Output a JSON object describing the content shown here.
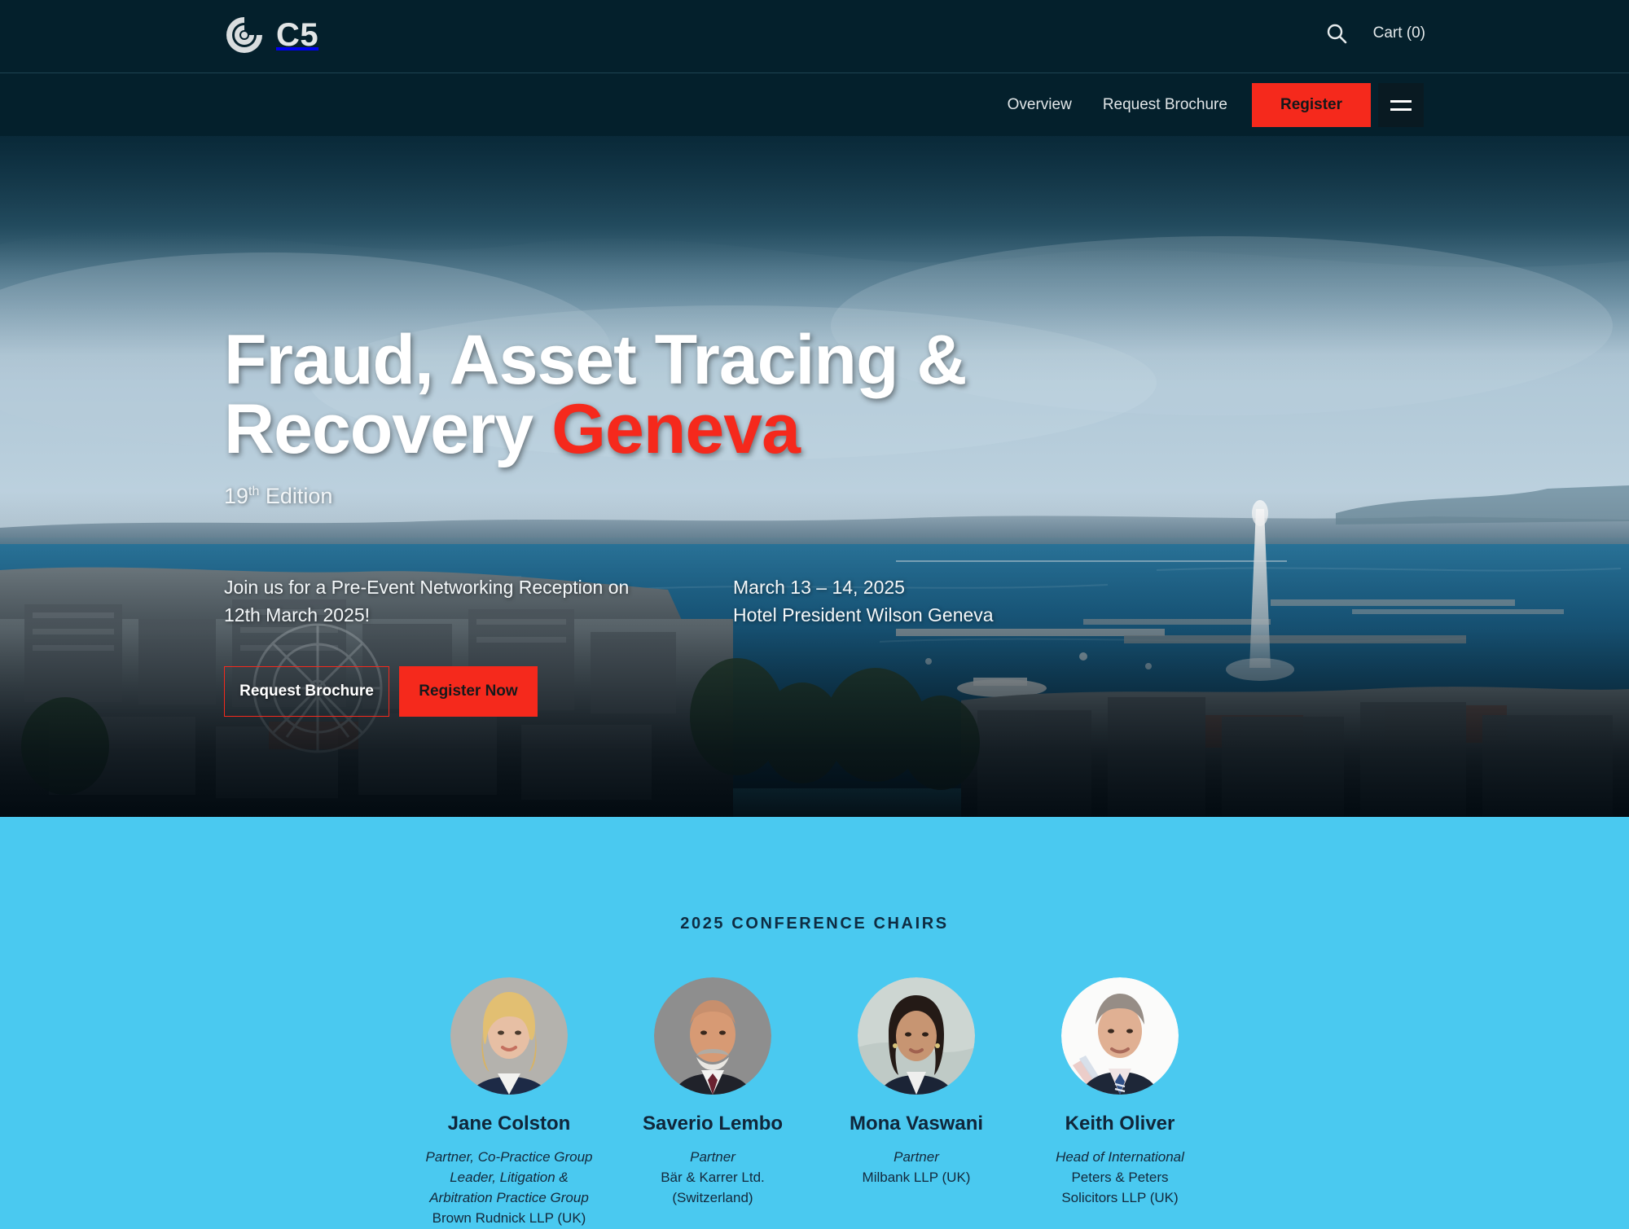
{
  "brand": {
    "name": "C5",
    "logo_icon": "c5-spiral-logo-icon"
  },
  "topbar": {
    "search_icon": "search-icon",
    "cart_label": "Cart (0)"
  },
  "subnav": {
    "links": [
      {
        "label": "Overview"
      },
      {
        "label": "Request Brochure"
      }
    ],
    "register_label": "Register",
    "menu_icon": "hamburger-menu-icon"
  },
  "hero": {
    "title_line1": "Fraud, Asset Tracing &",
    "title_line2_plain": "Recovery ",
    "title_line2_accent": "Geneva",
    "edition_number": "19",
    "edition_suffix": "th",
    "edition_word": " Edition",
    "reception_line1": "Join us for a Pre-Event Networking Reception on",
    "reception_line2": "12th March 2025!",
    "dates": "March 13 – 14, 2025",
    "venue": "Hotel President Wilson Geneva",
    "btn_brochure": "Request Brochure",
    "btn_register": "Register Now",
    "accent_color": "#f5291c",
    "background_image": "geneva-lake-jet-deau-aerial-photo"
  },
  "chairs": {
    "heading": "2025 CONFERENCE CHAIRS",
    "background_color": "#4ac9f0",
    "people": [
      {
        "name": "Jane Colston",
        "title_lines": [
          "Partner, Co-Practice Group",
          "Leader, Litigation &",
          "Arbitration Practice Group"
        ],
        "firm_lines": [
          "Brown Rudnick LLP (UK)"
        ],
        "photo": "portrait-jane-colston"
      },
      {
        "name": "Saverio Lembo",
        "title_lines": [
          "Partner"
        ],
        "firm_lines": [
          "Bär & Karrer Ltd.",
          "(Switzerland)"
        ],
        "photo": "portrait-saverio-lembo"
      },
      {
        "name": "Mona Vaswani",
        "title_lines": [
          "Partner"
        ],
        "firm_lines": [
          "Milbank LLP (UK)"
        ],
        "photo": "portrait-mona-vaswani"
      },
      {
        "name": "Keith Oliver",
        "title_lines": [
          "Head of International"
        ],
        "firm_lines": [
          "Peters & Peters",
          "Solicitors LLP (UK)"
        ],
        "photo": "portrait-keith-oliver"
      }
    ]
  }
}
